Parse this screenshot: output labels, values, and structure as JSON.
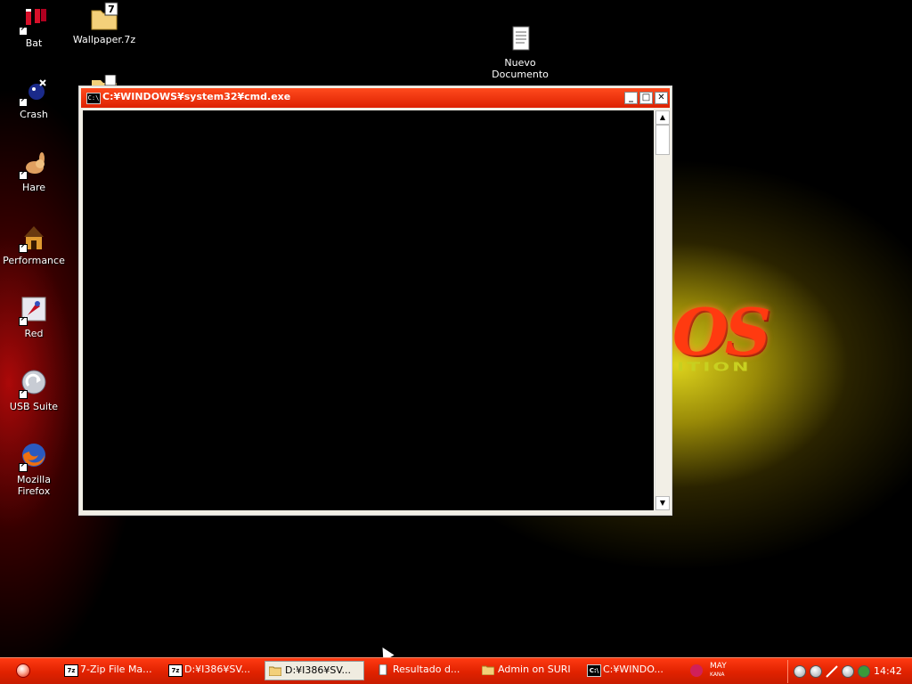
{
  "desktop": {
    "icons": [
      {
        "label": "Bat",
        "icon": "bat-file-icon"
      },
      {
        "label": "Wallpaper.7z",
        "icon": "7z-archive-icon"
      },
      {
        "label": "Nuevo\nDocumento ...",
        "icon": "text-document-icon"
      },
      {
        "label": "Crash",
        "icon": "crash-shortcut-icon"
      },
      {
        "label": "Hare",
        "icon": "hare-shortcut-icon"
      },
      {
        "label": "Performance",
        "icon": "performance-doghouse-icon"
      },
      {
        "label": "Red",
        "icon": "red-shortcut-icon"
      },
      {
        "label": "USB Suite",
        "icon": "usb-suite-icon"
      },
      {
        "label": "Mozilla Firefox",
        "icon": "firefox-icon"
      }
    ],
    "wallpaper_logo": "OS",
    "wallpaper_subtext": "ITION"
  },
  "cmd_window": {
    "title": "C:¥WINDOWS¥system32¥cmd.exe",
    "icon_text": "C:\\",
    "minimize": "_",
    "maximize": "□",
    "close": "✕",
    "scroll_up": "▲",
    "scroll_down": "▼"
  },
  "taskbar": {
    "tasks": [
      {
        "label": "7-Zip File Ma...",
        "icon": "7z",
        "active": false
      },
      {
        "label": "D:¥I386¥SV...",
        "icon": "7z",
        "active": false
      },
      {
        "label": "D:¥I386¥SV...",
        "icon": "folder",
        "active": true
      },
      {
        "label": "Resultado d...",
        "icon": "document",
        "active": false
      },
      {
        "label": "Admin on SURI",
        "icon": "folder",
        "active": false
      },
      {
        "label": "C:¥WINDO...",
        "icon": "cmd",
        "active": false
      }
    ],
    "ime": {
      "mode": "MAY",
      "sub": "KANA"
    },
    "clock": "14:42"
  },
  "colors": {
    "taskbar": "#e02200",
    "titlebar": "#ff4a1e",
    "glow": "#e8de1e"
  }
}
